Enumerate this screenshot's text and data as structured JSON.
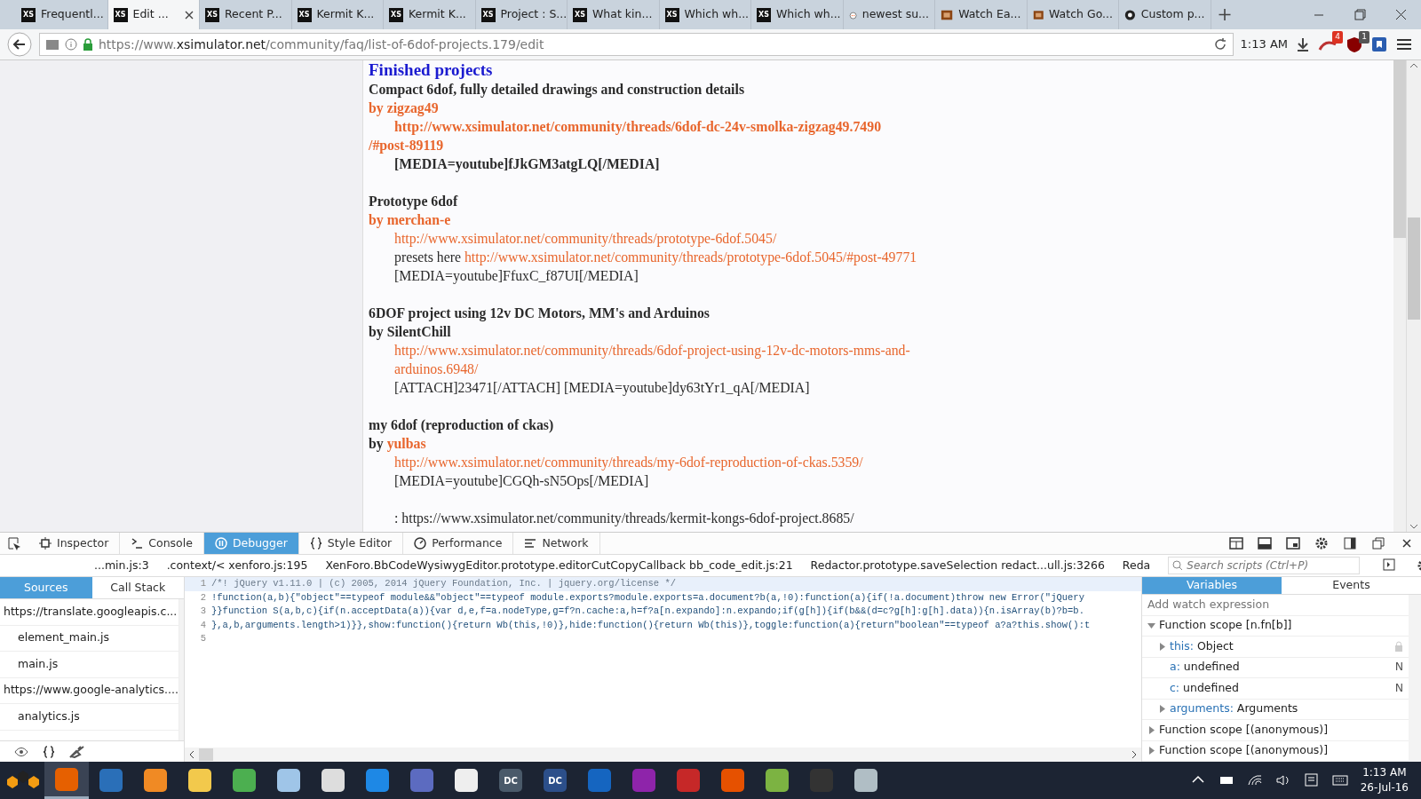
{
  "browser": {
    "tabs": [
      {
        "label": "Frequentl...",
        "selected": false,
        "kind": "xs",
        "favicon_text": "XS"
      },
      {
        "label": "Edit ...",
        "selected": true,
        "kind": "xs",
        "favicon_text": "XS"
      },
      {
        "label": "Recent P...",
        "selected": false,
        "kind": "xs",
        "favicon_text": "XS"
      },
      {
        "label": "Kermit K...",
        "selected": false,
        "kind": "xs",
        "favicon_text": "XS"
      },
      {
        "label": "Kermit K...",
        "selected": false,
        "kind": "xs",
        "favicon_text": "XS"
      },
      {
        "label": "Project : S...",
        "selected": false,
        "kind": "xs",
        "favicon_text": "XS"
      },
      {
        "label": "What kin...",
        "selected": false,
        "kind": "xs",
        "favicon_text": "XS"
      },
      {
        "label": "Which wh...",
        "selected": false,
        "kind": "xs",
        "favicon_text": "XS"
      },
      {
        "label": "Which wh...",
        "selected": false,
        "kind": "xs",
        "favicon_text": "XS"
      },
      {
        "label": "newest su...",
        "selected": false,
        "kind": "reddit"
      },
      {
        "label": "Watch Ea...",
        "selected": false,
        "kind": "film"
      },
      {
        "label": "Watch Go...",
        "selected": false,
        "kind": "film"
      },
      {
        "label": "Custom p...",
        "selected": false,
        "kind": "github"
      }
    ],
    "url": {
      "prefix": "https://www.",
      "domain": "xsimulator.net",
      "path": "/community/faq/list-of-6dof-projects.179/edit"
    },
    "clock": "1:13 AM",
    "badges": [
      "4",
      "1"
    ]
  },
  "editor": {
    "lines": [
      {
        "kind": "text",
        "indented": false,
        "segments": [
          {
            "kind": "heading",
            "text": "Finished projects"
          }
        ]
      },
      {
        "kind": "text",
        "indented": false,
        "segments": [
          {
            "kind": "bold",
            "text": "Compact 6dof, fully detailed drawings and construction details"
          }
        ]
      },
      {
        "kind": "text",
        "indented": false,
        "segments": [
          {
            "kind": "bold-link",
            "text": "by zigzag49"
          }
        ]
      },
      {
        "kind": "text",
        "indented": true,
        "segments": [
          {
            "kind": "bold-link",
            "text": "http://www.xsimulator.net/community/threads/6dof-dc-24v-smolka-zigzag49.7490"
          }
        ]
      },
      {
        "kind": "text",
        "indented": false,
        "segments": [
          {
            "kind": "bold-link",
            "text": "/#post-89119"
          }
        ]
      },
      {
        "kind": "text",
        "indented": true,
        "segments": [
          {
            "kind": "bold",
            "text": "[MEDIA=youtube]fJkGM3atgLQ[/MEDIA]"
          }
        ]
      },
      {
        "kind": "blank"
      },
      {
        "kind": "text",
        "indented": false,
        "segments": [
          {
            "kind": "bold",
            "text": "Prototype 6dof"
          }
        ]
      },
      {
        "kind": "text",
        "indented": false,
        "segments": [
          {
            "kind": "bold-link",
            "text": "by merchan-e"
          }
        ]
      },
      {
        "kind": "text",
        "indented": true,
        "segments": [
          {
            "kind": "link",
            "text": "http://www.xsimulator.net/community/threads/prototype-6dof.5045/"
          }
        ]
      },
      {
        "kind": "text",
        "indented": true,
        "segments": [
          {
            "kind": "plain",
            "text": "presets here "
          },
          {
            "kind": "link",
            "text": "http://www.xsimulator.net/community/threads/prototype-6dof.5045/#post-49771"
          }
        ]
      },
      {
        "kind": "text",
        "indented": true,
        "segments": [
          {
            "kind": "plain",
            "text": "[MEDIA=youtube]FfuxC_f87UI[/MEDIA]"
          }
        ]
      },
      {
        "kind": "blank"
      },
      {
        "kind": "text",
        "indented": false,
        "segments": [
          {
            "kind": "bold",
            "text": "6DOF project using 12v DC Motors, MM's and Arduinos"
          }
        ]
      },
      {
        "kind": "text",
        "indented": false,
        "segments": [
          {
            "kind": "bold",
            "text": "by SilentChill"
          }
        ]
      },
      {
        "kind": "text",
        "indented": true,
        "segments": [
          {
            "kind": "link",
            "text": "http://www.xsimulator.net/community/threads/6dof-project-using-12v-dc-motors-mms-and-"
          }
        ]
      },
      {
        "kind": "text",
        "indented": true,
        "segments": [
          {
            "kind": "link",
            "text": "arduinos.6948/"
          }
        ]
      },
      {
        "kind": "text",
        "indented": true,
        "segments": [
          {
            "kind": "plain",
            "text": "[ATTACH]23471[/ATTACH] [MEDIA=youtube]dy63tYr1_qA[/MEDIA]"
          }
        ]
      },
      {
        "kind": "blank"
      },
      {
        "kind": "text",
        "indented": false,
        "segments": [
          {
            "kind": "bold",
            "text": "my 6dof (reproduction of ckas)"
          }
        ]
      },
      {
        "kind": "text",
        "indented": false,
        "segments": [
          {
            "kind": "bold",
            "text": "by "
          },
          {
            "kind": "bold-link",
            "text": "yulbas"
          }
        ]
      },
      {
        "kind": "text",
        "indented": true,
        "segments": [
          {
            "kind": "link",
            "text": "http://www.xsimulator.net/community/threads/my-6dof-reproduction-of-ckas.5359/"
          }
        ]
      },
      {
        "kind": "text",
        "indented": true,
        "segments": [
          {
            "kind": "plain",
            "text": "[MEDIA=youtube]CGQh-sN5Ops[/MEDIA]"
          }
        ]
      },
      {
        "kind": "blank"
      },
      {
        "kind": "text",
        "indented": true,
        "segments": [
          {
            "kind": "plain",
            "text": ": https://www.xsimulator.net/community/threads/kermit-kongs-6dof-project.8685/"
          }
        ]
      }
    ]
  },
  "devtools": {
    "tabs": [
      {
        "label": "Inspector",
        "selected": false,
        "kind": "inspector"
      },
      {
        "label": "Console",
        "selected": false,
        "kind": "console"
      },
      {
        "label": "Debugger",
        "selected": true,
        "kind": "debugger"
      },
      {
        "label": "Style Editor",
        "selected": false,
        "kind": "style"
      },
      {
        "label": "Performance",
        "selected": false,
        "kind": "performance"
      },
      {
        "label": "Network",
        "selected": false,
        "kind": "network"
      }
    ],
    "breadcrumbs": [
      "...min.js:3",
      ".context/< xenforo.js:195",
      "XenForo.BbCodeWysiwygEditor.prototype.editorCutCopyCallback bb_code_edit.js:21",
      "Redactor.prototype.saveSelection redact...ull.js:3266",
      "Reda"
    ],
    "search": {
      "placeholder": "Search scripts (Ctrl+P)"
    },
    "source_tabs": [
      {
        "label": "Sources",
        "selected": true
      },
      {
        "label": "Call Stack",
        "selected": false
      }
    ],
    "sources": [
      {
        "kind": "domain",
        "label": "https://translate.googleapis.c..."
      },
      {
        "kind": "file",
        "label": "element_main.js"
      },
      {
        "kind": "file",
        "label": "main.js"
      },
      {
        "kind": "domain",
        "label": "https://www.google-analytics...."
      },
      {
        "kind": "file",
        "label": "analytics.js"
      }
    ],
    "code": [
      {
        "number": "1",
        "highlighted": true,
        "code": "/*! jQuery v1.11.0 | (c) 2005, 2014 jQuery Foundation, Inc. | jquery.org/license */"
      },
      {
        "number": "2",
        "highlighted": false,
        "code": "!function(a,b){\"object\"==typeof module&&\"object\"==typeof module.exports?module.exports=a.document?b(a,!0):function(a){if(!a.document)throw new Error(\"jQuery"
      },
      {
        "number": "3",
        "highlighted": false,
        "code": "}}function S(a,b,c){if(n.acceptData(a)){var d,e,f=a.nodeType,g=f?n.cache:a,h=f?a[n.expando]:n.expando;if(g[h]){if(b&&(d=c?g[h]:g[h].data)){n.isArray(b)?b=b."
      },
      {
        "number": "4",
        "highlighted": false,
        "code": "},a,b,arguments.length>1)}},show:function(){return Wb(this,!0)},hide:function(){return Wb(this)},toggle:function(a){return\"boolean\"==typeof a?a?this.show():t"
      },
      {
        "number": "5",
        "highlighted": false
      }
    ],
    "variable_tabs": [
      {
        "label": "Variables",
        "selected": true
      },
      {
        "label": "Events",
        "selected": false
      }
    ],
    "watch": {
      "placeholder": "Add watch expression"
    },
    "scopes": [
      {
        "label": "Function scope [n.fn[b]]",
        "expanded": true,
        "children": [
          {
            "name": "this:",
            "value": "Object",
            "expandable": true,
            "locked": true
          },
          {
            "name": "a:",
            "value": "undefined",
            "expandable": false,
            "flag": "N"
          },
          {
            "name": "c:",
            "value": "undefined",
            "expandable": false,
            "flag": "N"
          },
          {
            "name": "arguments:",
            "value": "Arguments",
            "expandable": true
          }
        ]
      },
      {
        "label": "Function scope [(anonymous)]",
        "expanded": false
      },
      {
        "label": "Function scope [(anonymous)]",
        "expanded": false
      }
    ]
  },
  "taskbar": {
    "apps": [
      {
        "color": "#e66000",
        "selected": true
      },
      {
        "color": "#2a6fb8",
        "selected": false
      },
      {
        "color": "#f08a24",
        "selected": false
      },
      {
        "color": "#f2c94c",
        "selected": false
      },
      {
        "color": "#4caf50",
        "selected": false
      },
      {
        "color": "#9fc5e8",
        "selected": false
      },
      {
        "color": "#dddddd",
        "selected": false
      },
      {
        "color": "#1e88e5",
        "selected": false
      },
      {
        "color": "#5c6bc0",
        "selected": false
      },
      {
        "color": "#eeeeee",
        "selected": false
      },
      {
        "color": "#4a5a6a",
        "selected": false,
        "label": "DC"
      },
      {
        "color": "#2c4f8a",
        "selected": false,
        "label": "DC"
      },
      {
        "color": "#1565c0",
        "selected": false
      },
      {
        "color": "#8e24aa",
        "selected": false
      },
      {
        "color": "#c62828",
        "selected": false
      },
      {
        "color": "#e65100",
        "selected": false
      },
      {
        "color": "#7cb342",
        "selected": false
      },
      {
        "color": "#333333",
        "selected": false
      },
      {
        "color": "#b0bec5",
        "selected": false
      }
    ],
    "time": "1:13 AM",
    "date": "26-Jul-16"
  }
}
